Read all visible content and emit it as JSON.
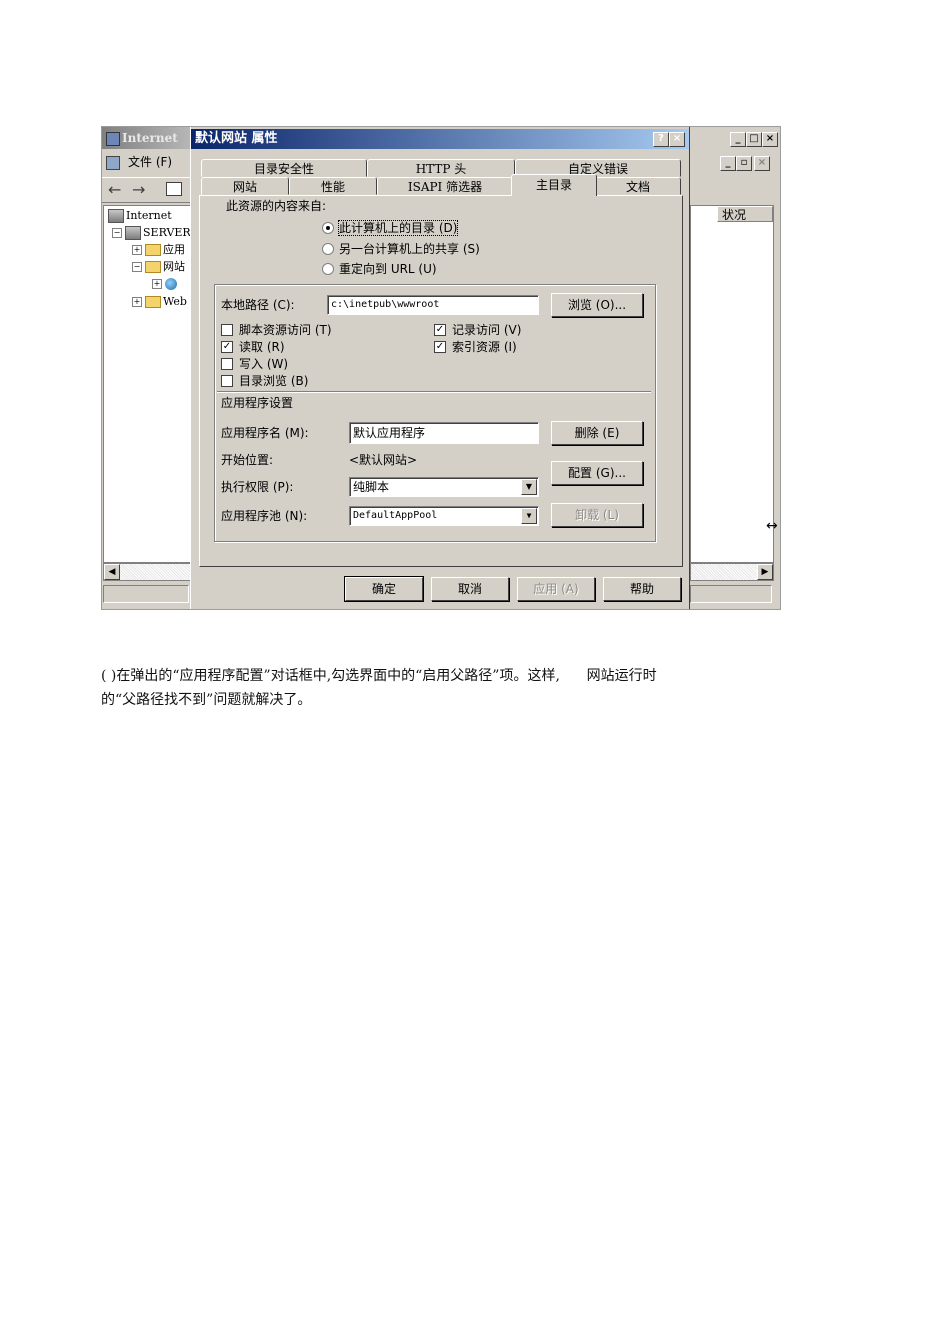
{
  "mmc": {
    "title": "Internet",
    "menu_file": "文件 (F)",
    "tree": {
      "root": "Internet",
      "server": "SERVER",
      "app_pool": "应用",
      "sites": "网站",
      "web": "Web"
    },
    "status_column": "状况"
  },
  "dialog": {
    "title": "默认网站 属性",
    "title_buttons": [
      "?",
      "×"
    ],
    "tabs_back": [
      "目录安全性",
      "HTTP 头",
      "自定义错误"
    ],
    "tabs_front": [
      "网站",
      "性能",
      "ISAPI 筛选器",
      "主目录",
      "文档"
    ],
    "active_tab": "主目录",
    "content_source_label": "此资源的内容来自:",
    "source_options": [
      {
        "label": "此计算机上的目录 (D)",
        "selected": true
      },
      {
        "label": "另一台计算机上的共享 (S)",
        "selected": false
      },
      {
        "label": "重定向到 URL (U)",
        "selected": false
      }
    ],
    "local_path_label": "本地路径 (C):",
    "local_path_value": "c:\\inetpub\\wwwroot",
    "browse_button": "浏览 (O)...",
    "permissions_left": [
      {
        "label": "脚本资源访问 (T)",
        "checked": false
      },
      {
        "label": "读取 (R)",
        "checked": true
      },
      {
        "label": "写入 (W)",
        "checked": false
      },
      {
        "label": "目录浏览 (B)",
        "checked": false
      }
    ],
    "permissions_right": [
      {
        "label": "记录访问 (V)",
        "checked": true
      },
      {
        "label": "索引资源 (I)",
        "checked": true
      }
    ],
    "app_settings_heading": "应用程序设置",
    "app_name_label": "应用程序名 (M):",
    "app_name_value": "默认应用程序",
    "remove_button": "删除 (E)",
    "start_point_label": "开始位置:",
    "start_point_value": "<默认网站>",
    "config_button": "配置 (G)...",
    "exec_perm_label": "执行权限 (P):",
    "exec_perm_value": "纯脚本",
    "app_pool_label": "应用程序池 (N):",
    "app_pool_value": "DefaultAppPool",
    "unload_button": "卸载 (L)",
    "ok_button": "确定",
    "cancel_button": "取消",
    "apply_button": "应用 (A)",
    "help_button": "帮助"
  },
  "paragraph": {
    "line1": "( )在弹出的“应用程序配置”对话框中,勾选界面中的“启用父路径”项。这样,      网站运行时",
    "line2": "的“父路径找不到”问题就解决了。"
  }
}
